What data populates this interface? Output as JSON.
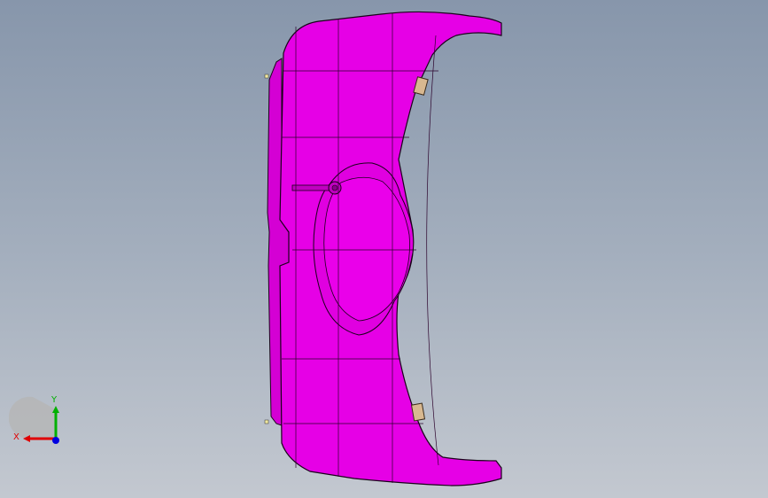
{
  "colors": {
    "background_top": "#8796ab",
    "background_bottom": "#c3c8d0",
    "part_fill": "#e600e6",
    "part_edge": "#1a001a",
    "axis_x": "#e00000",
    "axis_y": "#00b000",
    "axis_z": "#0000e0"
  },
  "model": {
    "part_name_icon": "curved-housing-part-3d",
    "view": "front-orthographic"
  },
  "triad": {
    "x_label": "X",
    "y_label": "Y"
  }
}
